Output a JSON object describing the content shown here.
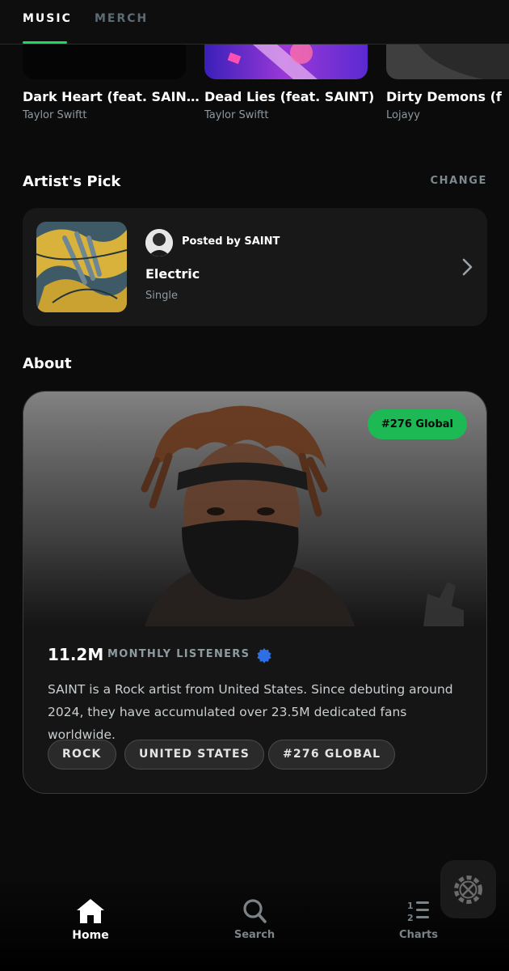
{
  "top_tabs": {
    "music": "MUSIC",
    "merch": "MERCH"
  },
  "albums": [
    {
      "title": "Dark Heart (feat. SAIN…",
      "artist": "Taylor Swiftt"
    },
    {
      "title": "Dead Lies (feat. SAINT)",
      "artist": "Taylor Swiftt"
    },
    {
      "title": "Dirty Demons (f",
      "artist": "Lojayy"
    }
  ],
  "artists_pick": {
    "heading": "Artist's Pick",
    "change_label": "CHANGE",
    "posted_by": "Posted by SAINT",
    "title": "Electric",
    "type": "Single"
  },
  "about": {
    "heading": "About",
    "badge": "#276 Global",
    "monthly_listeners": "11.2M",
    "monthly_listeners_label": "MONTHLY LISTENERS",
    "bio": "SAINT is a Rock artist from United States. Since debuting around 2024, they have accumulated over 23.5M dedicated fans worldwide.",
    "tags": [
      "ROCK",
      "UNITED STATES",
      "#276 GLOBAL"
    ]
  },
  "bottom_nav": {
    "home": "Home",
    "search": "Search",
    "charts": "Charts"
  },
  "icons": {
    "pick_chevron": "chevron-right-icon",
    "verified": "verified-badge-icon",
    "tools": "tools-icon",
    "home": "home-icon",
    "search": "search-icon",
    "charts": "charts-icon"
  },
  "colors": {
    "accent": "#1db954",
    "background": "#0b0b0b",
    "card": "#181818"
  }
}
